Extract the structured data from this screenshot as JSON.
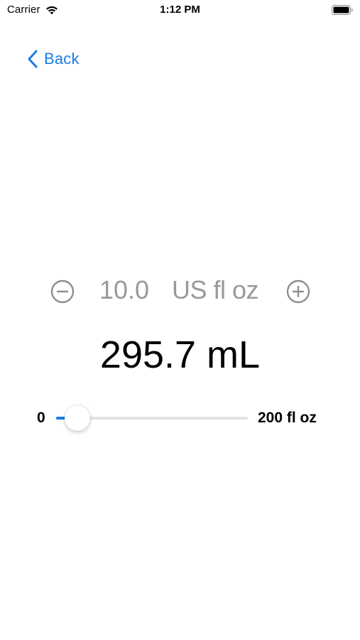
{
  "status_bar": {
    "carrier": "Carrier",
    "time": "1:12 PM",
    "wifi_icon": "wifi-icon",
    "battery_icon": "battery-full-icon"
  },
  "nav": {
    "back_label": "Back",
    "back_icon": "chevron-left-icon",
    "accent_color": "#1a7ce6"
  },
  "stepper": {
    "value": "10.0",
    "unit": "US fl oz",
    "decrement_icon": "minus-circle-icon",
    "increment_icon": "plus-circle-icon",
    "text_color": "#999999"
  },
  "result": {
    "text": "295.7 mL"
  },
  "slider": {
    "min_label": "0",
    "max_label": "200 fl oz",
    "min": 0,
    "max": 200,
    "value": 10,
    "fill_color": "#1a7ce6",
    "track_color": "#e3e3e6"
  }
}
